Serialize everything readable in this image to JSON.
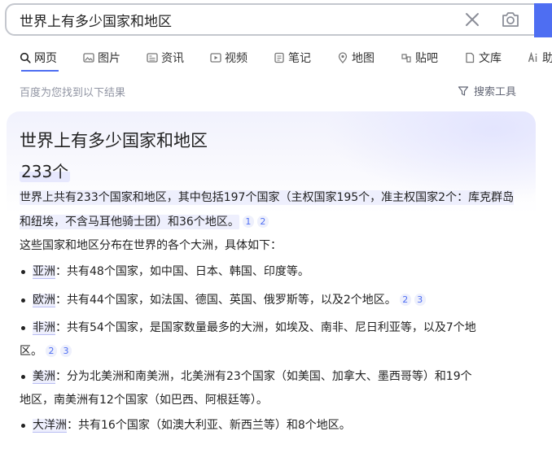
{
  "search": {
    "query": "世界上有多少国家和地区"
  },
  "tabs": [
    {
      "label": "网页",
      "icon": "search-icon",
      "active": true
    },
    {
      "label": "图片",
      "icon": "image-icon"
    },
    {
      "label": "资讯",
      "icon": "news-icon"
    },
    {
      "label": "视频",
      "icon": "video-icon"
    },
    {
      "label": "笔记",
      "icon": "note-icon"
    },
    {
      "label": "地图",
      "icon": "map-pin-icon"
    },
    {
      "label": "贴吧",
      "icon": "tieba-icon"
    },
    {
      "label": "文库",
      "icon": "document-icon"
    },
    {
      "label": "助",
      "icon": "ai-icon"
    }
  ],
  "results": {
    "count_text": "百度为您找到以下结果",
    "tools_label": "搜索工具"
  },
  "answer_card": {
    "title": "世界上有多少国家和地区",
    "answer": "233个",
    "summary": "世界上共有233个国家和地区，其中包括197个国家（主权国家195个，准主权国家2个：库克群岛和纽埃，不含马耳他骑士团）和36个地区。",
    "summary_cites": [
      "1",
      "2"
    ],
    "intro": "这些国家和地区分布在世界的各个大洲，具体如下：",
    "continents": [
      {
        "name": "亚洲",
        "text_line1": "：共有48个国家，如中国、日本、韩国、印度等。",
        "text_line2": "",
        "cites": []
      },
      {
        "name": "欧洲",
        "text_line1": "：共有44个国家，如法国、德国、英国、俄罗斯等，以及2个地区。",
        "text_line2": "",
        "cites": [
          "2",
          "3"
        ]
      },
      {
        "name": "非洲",
        "text_line1": "：共有54个国家，是国家数量最多的大洲，如埃及、南非、尼日利亚等，以及7个地",
        "text_line2": "区。",
        "cites": [
          "2",
          "3"
        ]
      },
      {
        "name": "美洲",
        "text_line1": "：分为北美洲和南美洲，北美洲有23个国家（如美国、加拿大、墨西哥等）和19个",
        "text_line2": "地区，南美洲有12个国家（如巴西、阿根廷等）。",
        "cites": []
      },
      {
        "name": "大洋洲",
        "text_line1": "：共有16个国家（如澳大利亚、新西兰等）和8个地区。",
        "text_line2": "",
        "cites": []
      }
    ]
  },
  "colors": {
    "accent": "#4e6ef2",
    "highlight": "#eeeffd",
    "muted": "#9195a3"
  }
}
